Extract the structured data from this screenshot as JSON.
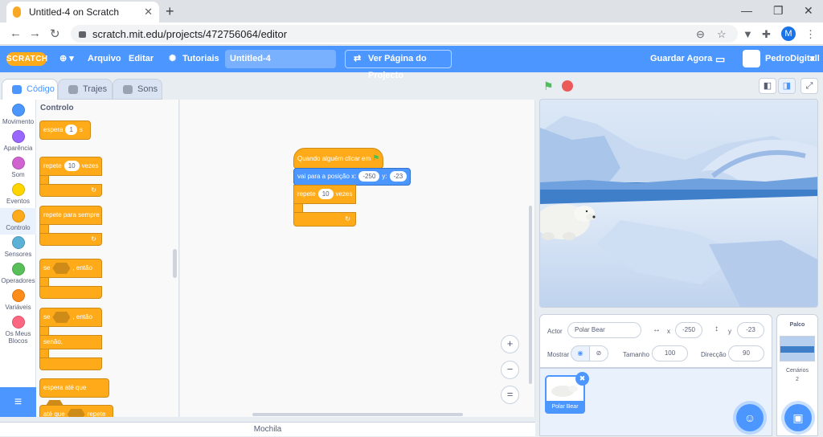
{
  "browser": {
    "tab_title": "Untitled-4 on Scratch",
    "url": "scratch.mit.edu/projects/472756064/editor",
    "profile_initial": "M"
  },
  "menubar": {
    "logo": "SCRATCH",
    "file": "Arquivo",
    "edit": "Editar",
    "tutorials": "Tutoriais",
    "project_title": "Untitled-4",
    "see_project": "Ver Página do Projecto",
    "save_now": "Guardar Agora",
    "username": "PedroDigitall"
  },
  "editor_tabs": {
    "code": "Código",
    "costumes": "Trajes",
    "sounds": "Sons"
  },
  "categories": [
    {
      "label": "Movimento",
      "color": "#4c97ff"
    },
    {
      "label": "Aparência",
      "color": "#9966ff"
    },
    {
      "label": "Som",
      "color": "#cf63cf"
    },
    {
      "label": "Eventos",
      "color": "#ffd500"
    },
    {
      "label": "Controlo",
      "color": "#ffab19"
    },
    {
      "label": "Sensores",
      "color": "#5cb1d6"
    },
    {
      "label": "Operadores",
      "color": "#59c059"
    },
    {
      "label": "Variáveis",
      "color": "#ff8c1a"
    },
    {
      "label": "Os Meus Blocos",
      "color": "#ff6680"
    }
  ],
  "palette": {
    "title": "Controlo",
    "wait": {
      "label": "espera",
      "value": "1",
      "unit": "s"
    },
    "repeat": {
      "label": "repete",
      "value": "10",
      "suffix": "vezes"
    },
    "forever": "repete para sempre",
    "if_then": {
      "prefix": "se",
      "suffix": ", então"
    },
    "if_else": {
      "prefix": "se",
      "suffix": ", então",
      "else": "senão,"
    },
    "wait_until": "espera até que",
    "repeat_until": {
      "prefix": "até que",
      "suffix": "repete"
    }
  },
  "script": {
    "hat": "Quando alguém clicar em",
    "goto": {
      "label": "vai para a posição x:",
      "x": "-250",
      "ylabel": "y:",
      "y": "-23"
    },
    "repeat": {
      "label": "repete",
      "value": "10",
      "suffix": "vezes"
    }
  },
  "backpack": "Mochila",
  "sprite_info": {
    "sprite_label": "Actor",
    "sprite_name": "Polar Bear",
    "x_label": "x",
    "x": "-250",
    "y_label": "y",
    "y": "-23",
    "show_label": "Mostrar",
    "size_label": "Tamanho",
    "size": "100",
    "direction_label": "Direcção",
    "direction": "90"
  },
  "sprites": [
    {
      "name": "Polar Bear",
      "selected": true
    }
  ],
  "stage_panel": {
    "title": "Palco",
    "backdrops_label": "Cenários",
    "backdrops_count": "2"
  },
  "colors": {
    "accent": "#4c97ff",
    "control": "#ffab19",
    "motion": "#4c97ff",
    "flag": "#4cbf56",
    "stop": "#ec5959"
  }
}
